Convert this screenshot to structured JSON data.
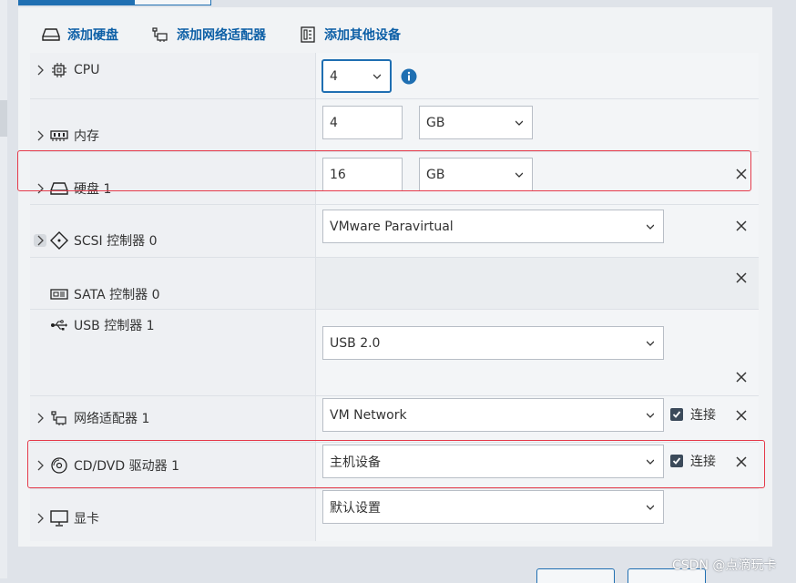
{
  "toolbar": {
    "add_disk": "添加硬盘",
    "add_network": "添加网络适配器",
    "add_other": "添加其他设备"
  },
  "rows": {
    "cpu": {
      "label": "CPU",
      "value": "4",
      "info_icon": "info-icon"
    },
    "memory": {
      "label": "内存",
      "value": "4",
      "unit": "GB"
    },
    "disk": {
      "label": "硬盘 1",
      "value": "16",
      "unit": "GB"
    },
    "scsi": {
      "label": "SCSI 控制器 0",
      "value": "VMware Paravirtual"
    },
    "sata": {
      "label": "SATA 控制器 0"
    },
    "usb": {
      "label": "USB 控制器 1",
      "value": "USB 2.0"
    },
    "network": {
      "label": "网络适配器 1",
      "value": "VM Network",
      "connect_label": "连接",
      "connected": true
    },
    "cdrom": {
      "label": "CD/DVD 驱动器 1",
      "value": "主机设备",
      "connect_label": "连接",
      "connected": true
    },
    "display": {
      "label": "显卡",
      "value": "默认设置"
    }
  },
  "colors": {
    "accent": "#1f6fb2",
    "link": "#0c5fa6",
    "highlight_red": "#e53a4a"
  },
  "watermark": "CSDN @点滴玩卡"
}
